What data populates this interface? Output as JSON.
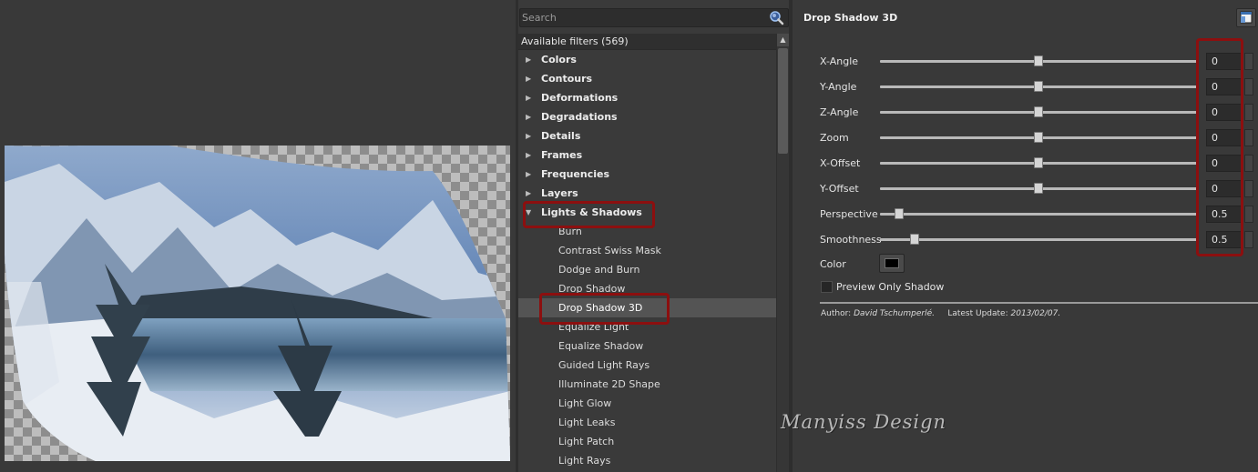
{
  "search": {
    "placeholder": "Search"
  },
  "filters": {
    "header": "Available filters (569)",
    "categories": [
      {
        "label": "Colors"
      },
      {
        "label": "Contours"
      },
      {
        "label": "Deformations"
      },
      {
        "label": "Degradations"
      },
      {
        "label": "Details"
      },
      {
        "label": "Frames"
      },
      {
        "label": "Frequencies"
      },
      {
        "label": "Layers"
      },
      {
        "label": "Lights & Shadows"
      }
    ],
    "items": [
      {
        "label": "Burn"
      },
      {
        "label": "Contrast Swiss Mask"
      },
      {
        "label": "Dodge and Burn"
      },
      {
        "label": "Drop Shadow"
      },
      {
        "label": "Drop Shadow 3D"
      },
      {
        "label": "Equalize Light"
      },
      {
        "label": "Equalize Shadow"
      },
      {
        "label": "Guided Light Rays"
      },
      {
        "label": "Illuminate 2D Shape"
      },
      {
        "label": "Light Glow"
      },
      {
        "label": "Light Leaks"
      },
      {
        "label": "Light Patch"
      },
      {
        "label": "Light Rays"
      }
    ]
  },
  "params": {
    "title": "Drop Shadow 3D",
    "sliders": [
      {
        "label": "X-Angle",
        "value": "0",
        "fraction": 0.5
      },
      {
        "label": "Y-Angle",
        "value": "0",
        "fraction": 0.5
      },
      {
        "label": "Z-Angle",
        "value": "0",
        "fraction": 0.5
      },
      {
        "label": "Zoom",
        "value": "0",
        "fraction": 0.5
      },
      {
        "label": "X-Offset",
        "value": "0",
        "fraction": 0.5
      },
      {
        "label": "Y-Offset",
        "value": "0",
        "fraction": 0.5
      },
      {
        "label": "Perspective",
        "value": "0.5",
        "fraction": 0.06
      },
      {
        "label": "Smoothness",
        "value": "0.5",
        "fraction": 0.11
      }
    ],
    "color_label": "Color",
    "color_value": "#000000",
    "preview_only_label": "Preview Only Shadow",
    "author_label": "Author:",
    "author": "David Tschumperlé.",
    "update_label": "Latest Update:",
    "update": "2013/02/07."
  },
  "watermark": "Manyiss Design",
  "colors": {
    "highlight_box": "#8c0f0f",
    "selection": "#545454"
  }
}
